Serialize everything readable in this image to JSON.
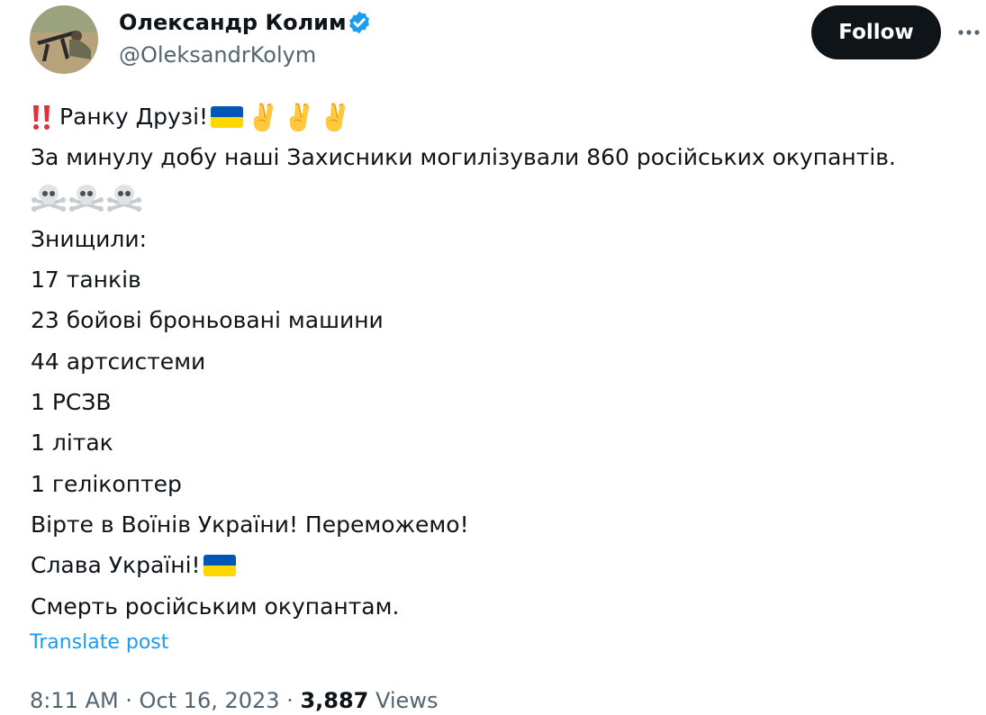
{
  "author": {
    "name": "Олександр Колим",
    "handle": "@OleksandrKolym"
  },
  "actions": {
    "follow_label": "Follow"
  },
  "post": {
    "greeting": "Ранку Друзі!",
    "line2": "За минулу добу наші Захисники могилізували 860 російських окупантів.",
    "line4": "Знищили:",
    "line5": "17 танків",
    "line6": "23 бойові броньовані машини",
    "line7": "44 артсистеми",
    "line8": "1 РСЗВ",
    "line9": "1 літак",
    "line10": "1 гелікоптер",
    "line11": "Вірте в Воїнів України! Переможемо!",
    "line12": "Слава Україні!",
    "line13": "Смерть російським окупантам."
  },
  "translate_label": "Translate post",
  "meta": {
    "time": "8:11 AM",
    "separator": " · ",
    "date": "Oct 16, 2023",
    "views_count": "3,887",
    "views_label": "Views"
  },
  "icons": {
    "avatar": "avatar-photo",
    "verified": "verified-badge-icon",
    "more": "more-options-icon",
    "double_exclamation": "double-exclamation-emoji",
    "flag": "ukraine-flag-emoji",
    "victory_hand": "victory-hand-emoji",
    "skull": "skull-crossbones-emoji"
  },
  "colors": {
    "verified_blue": "#1d9bf0",
    "link_blue": "#1d9bf0",
    "flag_blue": "#0057b7",
    "flag_yellow": "#ffd700",
    "secondary_text": "#536471",
    "primary_text": "#0f1419"
  }
}
